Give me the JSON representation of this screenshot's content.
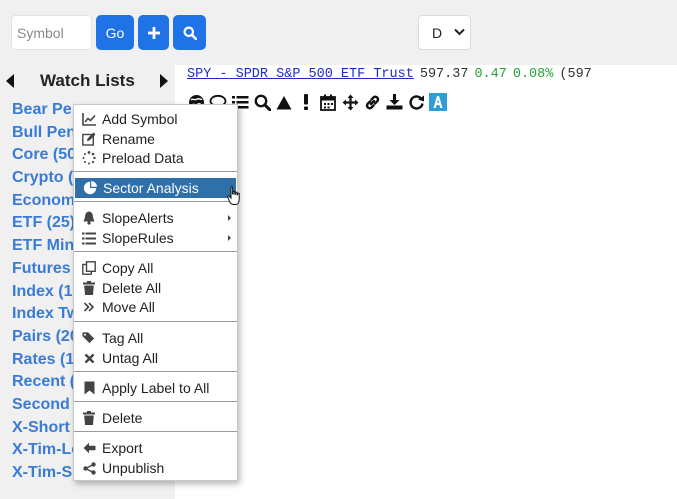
{
  "toolbar": {
    "symbol_placeholder": "Symbol",
    "go_label": "Go",
    "period_value": "D",
    "add_icon": "plus-icon",
    "search_icon": "search-icon",
    "accent": "#1f73e6"
  },
  "watchlists": {
    "title": "Watch Lists",
    "items": [
      "Bear Pe",
      "Bull Pen",
      "Core (50",
      "Crypto (",
      "Econom",
      "ETF (25)",
      "ETF Min",
      "Futures",
      "Index (1",
      "Index Tw",
      "Pairs (20",
      "Rates (1",
      "Recent (",
      "Second",
      "X-Short",
      "X-Tim-Lo",
      "X-Tim-Sl"
    ],
    "link_color": "#3a7bd5"
  },
  "quote": {
    "link": "SPY - SPDR S&P 500 ETF Trust",
    "price": "597.37",
    "change": "0.47",
    "change_pct": "0.08%",
    "extra": "(597",
    "up_color": "#27a33a"
  },
  "chart_tools": [
    "globe-icon",
    "comment-icon",
    "list-icon",
    "search-icon",
    "triangle-icon",
    "exclamation-icon",
    "calendar-icon",
    "move-icon",
    "link-icon",
    "download-icon",
    "refresh-icon",
    "letter-a-icon"
  ],
  "context_menu": {
    "highlight_color": "#2f6faa",
    "items": {
      "add_symbol": "Add Symbol",
      "rename": "Rename",
      "preload": "Preload Data",
      "sector": "Sector Analysis",
      "slope_alerts": "SlopeAlerts",
      "slope_rules": "SlopeRules",
      "copy_all": "Copy All",
      "delete_all": "Delete All",
      "move_all": "Move All",
      "tag_all": "Tag All",
      "untag_all": "Untag All",
      "apply_label": "Apply Label to All",
      "delete": "Delete",
      "export": "Export",
      "unpublish": "Unpublish"
    }
  }
}
